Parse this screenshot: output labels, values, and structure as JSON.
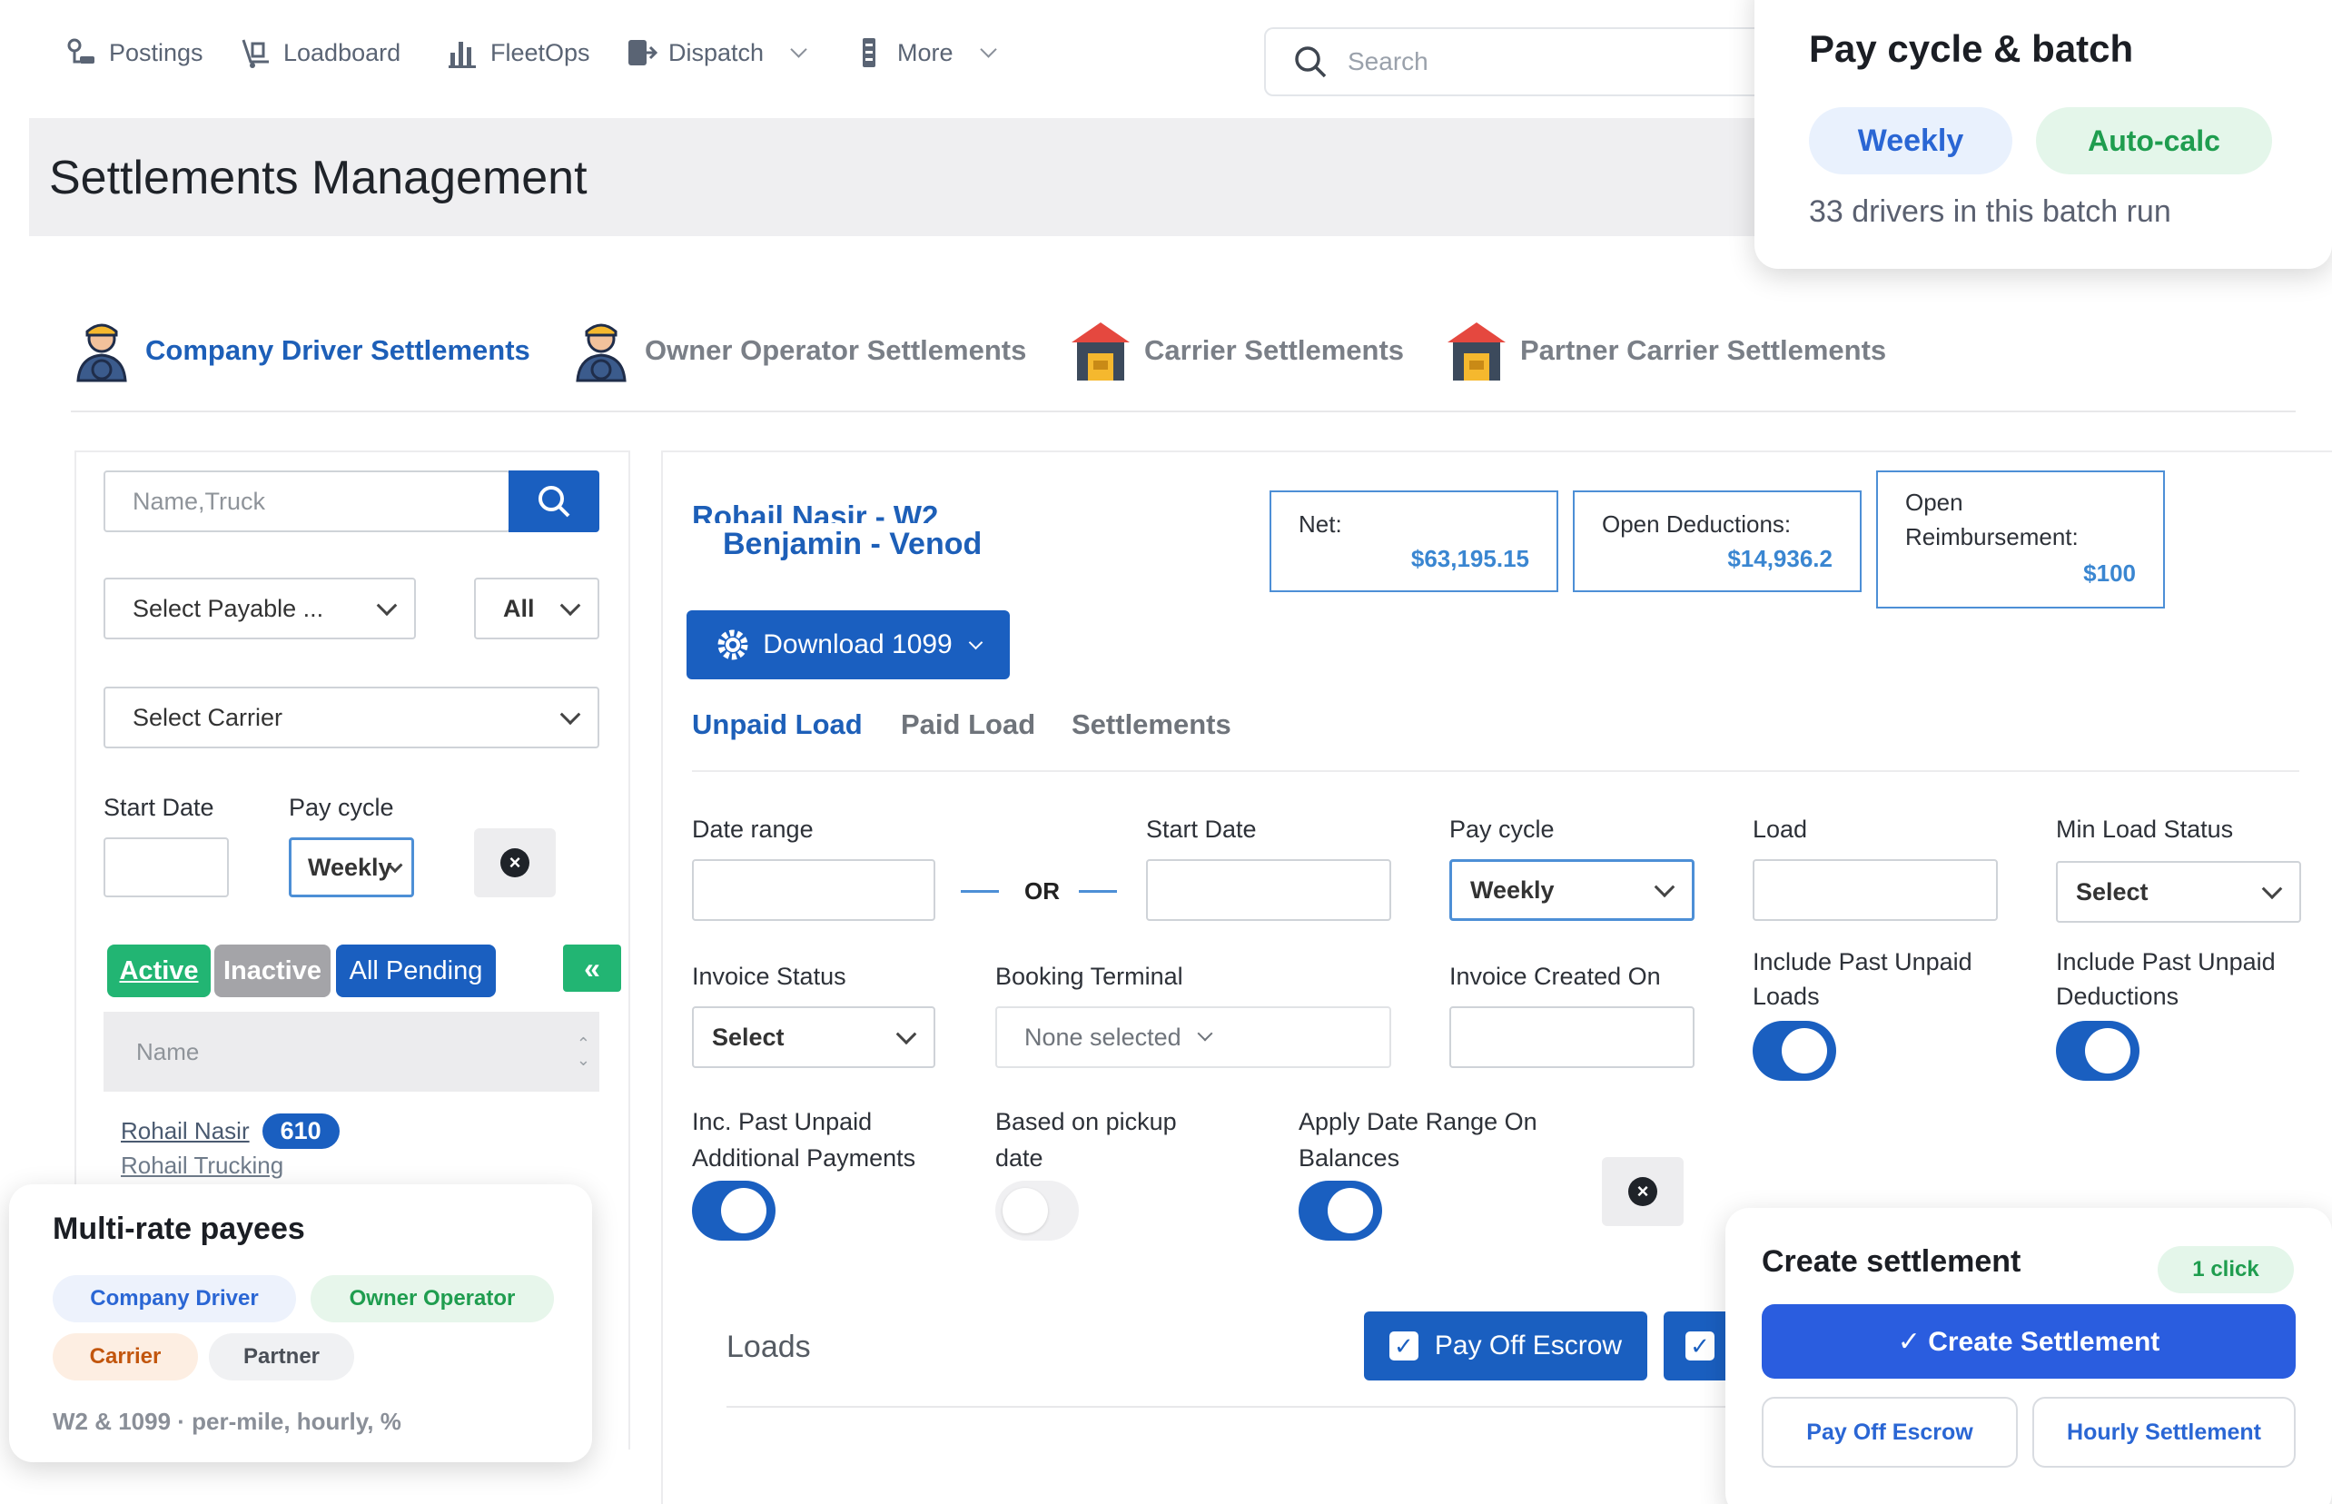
{
  "nav": {
    "items": [
      {
        "label": "Postings",
        "icon": "postings-icon"
      },
      {
        "label": "Loadboard",
        "icon": "loadboard-icon"
      },
      {
        "label": "FleetOps",
        "icon": "fleetops-icon"
      },
      {
        "label": "Dispatch",
        "icon": "dispatch-icon"
      },
      {
        "label": "More",
        "icon": "more-icon"
      }
    ],
    "search_placeholder": "Search"
  },
  "page_title": "Settlements Management",
  "settlement_tabs": [
    {
      "label": "Company Driver Settlements",
      "active": true
    },
    {
      "label": "Owner Operator Settlements",
      "active": false
    },
    {
      "label": "Carrier Settlements",
      "active": false
    },
    {
      "label": "Partner Carrier Settlements",
      "active": false
    }
  ],
  "left": {
    "search_placeholder": "Name,Truck",
    "payable_select": "Select Payable ...",
    "all_select": "All",
    "carrier_select": "Select Carrier",
    "start_date_label": "Start Date",
    "pay_cycle_label": "Pay cycle",
    "pay_cycle_value": "Weekly",
    "filters": {
      "active": "Active",
      "inactive": "Inactive",
      "all_pending": "All Pending"
    },
    "name_header": "Name",
    "driver_name": "Rohail Nasir",
    "driver_badge": "610",
    "driver_company": "Rohail Trucking"
  },
  "main": {
    "driver_title_1": "Rohail Nasir - W2",
    "driver_title_2": "Benjamin - Venod",
    "download_label": "Download 1099",
    "stats": {
      "net_label": "Net:",
      "net_value": "$63,195.15",
      "open_deductions_label": "Open Deductions:",
      "open_deductions_value": "$14,936.2",
      "open_reimb_label_1": "Open",
      "open_reimb_label_2": "Reimbursement:",
      "open_reimb_value": "$100"
    },
    "subtabs": [
      "Unpaid Load",
      "Paid Load",
      "Settlements"
    ],
    "filters": {
      "date_range": "Date range",
      "or": "OR",
      "start_date": "Start Date",
      "pay_cycle": "Pay cycle",
      "pay_cycle_value": "Weekly",
      "load": "Load",
      "min_load_status": "Min Load Status",
      "min_load_status_value": "Select",
      "invoice_status": "Invoice Status",
      "invoice_status_value": "Select",
      "booking_terminal": "Booking Terminal",
      "booking_terminal_value": "None selected",
      "invoice_created_on": "Invoice Created On",
      "include_past_unpaid_loads_1": "Include Past Unpaid",
      "include_past_unpaid_loads_2": "Loads",
      "include_past_unpaid_deductions_1": "Include Past Unpaid",
      "include_past_unpaid_deductions_2": "Deductions",
      "inc_past_unpaid_additional_1": "Inc. Past Unpaid",
      "inc_past_unpaid_additional_2": "Additional Payments",
      "based_on_pickup_1": "Based on pickup",
      "based_on_pickup_2": "date",
      "apply_date_range_1": "Apply Date Range On",
      "apply_date_range_2": "Balances"
    },
    "toggles": {
      "include_past_unpaid_loads": true,
      "include_past_unpaid_deductions": true,
      "inc_past_unpaid_additional": true,
      "based_on_pickup": false,
      "apply_date_range": true
    },
    "loads_label": "Loads",
    "pay_off_escrow": "Pay Off Escrow"
  },
  "card_paycycle": {
    "title": "Pay cycle & batch",
    "chip_weekly": "Weekly",
    "chip_autocalc": "Auto-calc",
    "subtitle": "33 drivers in this batch run"
  },
  "card_multirate": {
    "title": "Multi-rate payees",
    "chips": [
      "Company Driver",
      "Owner Operator",
      "Carrier",
      "Partner"
    ],
    "footer": "W2 & 1099 · per-mile, hourly, %"
  },
  "card_create": {
    "title": "Create settlement",
    "badge": "1 click",
    "primary": "✓ Create Settlement",
    "secondary_1": "Pay Off Escrow",
    "secondary_2": "Hourly Settlement"
  },
  "colors": {
    "accent": "#1a5fc0",
    "link": "#1d5fb8",
    "value": "#3a86d1",
    "active_green": "#22b573",
    "inactive_gray": "#a4a4a8",
    "create_blue": "#2a5ddf"
  }
}
